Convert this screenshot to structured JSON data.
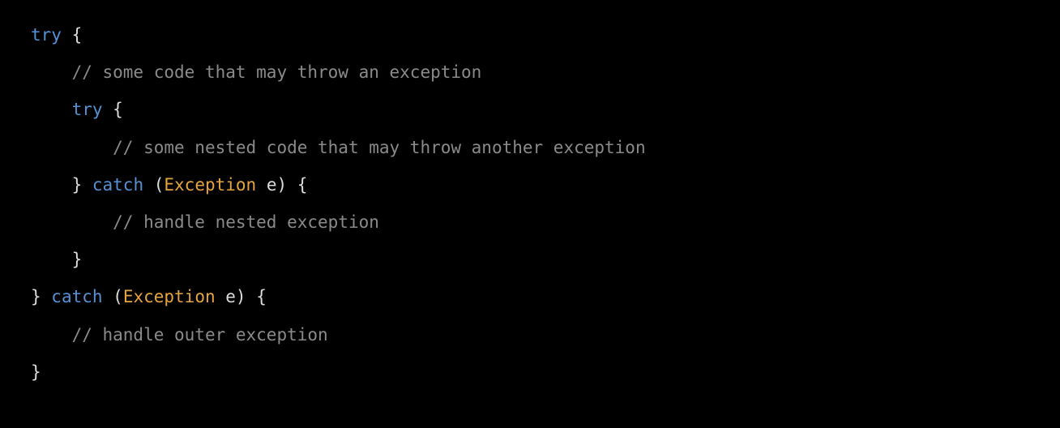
{
  "code": {
    "l1_try": "try",
    "l1_brace_open": " {",
    "l2_comment": "// some code that may throw an exception",
    "l3_try": "try",
    "l3_brace_open": " {",
    "l4_comment": "// some nested code that may throw another exception",
    "l5_brace_close": "} ",
    "l5_catch": "catch",
    "l5_paren_open": " (",
    "l5_type": "Exception",
    "l5_var": " e",
    "l5_paren_brace": ") {",
    "l6_comment": "// handle nested exception",
    "l7_brace": "}",
    "l8_brace_close": "} ",
    "l8_catch": "catch",
    "l8_paren_open": " (",
    "l8_type": "Exception",
    "l8_var": " e",
    "l8_paren_brace": ") {",
    "l9_comment": "// handle outer exception",
    "l10_brace": "}"
  },
  "indent": {
    "i1": "    ",
    "i2": "        "
  }
}
